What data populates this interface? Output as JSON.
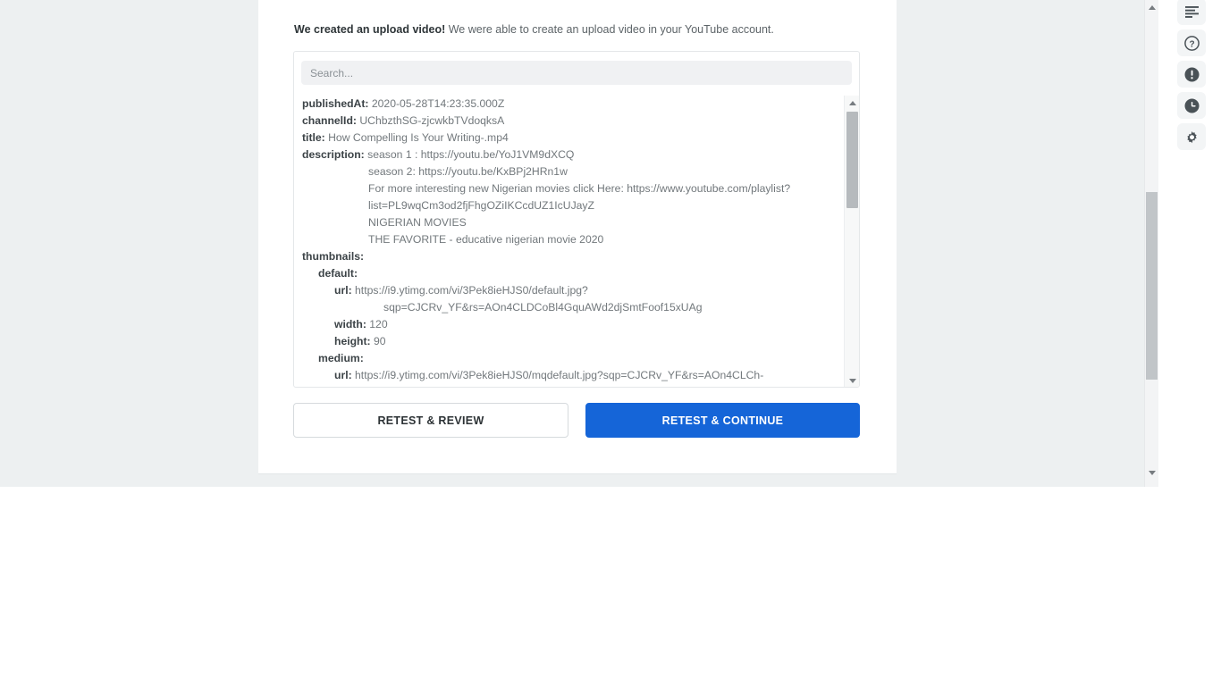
{
  "alert": {
    "strong": "We created an upload video!",
    "text": " We were able to create an upload video in your YouTube account."
  },
  "json_viewer": {
    "search": {
      "placeholder": "Search...",
      "value": ""
    },
    "rows": [
      {
        "indent": 0,
        "key": "publishedAt:",
        "value": "2020-05-28T14:23:35.000Z"
      },
      {
        "indent": 0,
        "key": "channelId:",
        "value": "UChbzthSG-zjcwkbTVdoqksA"
      },
      {
        "indent": 0,
        "key": "title:",
        "value": "How Compelling Is Your Writing-.mp4"
      },
      {
        "indent": 0,
        "key": "description:",
        "value": "season 1 : https://youtu.be/YoJ1VM9dXCQ"
      },
      {
        "indent": "desc",
        "key": "",
        "value": "season 2: https://youtu.be/KxBPj2HRn1w"
      },
      {
        "indent": "desc",
        "key": "",
        "value": "For more interesting new Nigerian movies click Here: https://www.youtube.com/playlist?"
      },
      {
        "indent": "desc",
        "key": "",
        "value": "list=PL9wqCm3od2fjFhgOZiIKCcdUZ1IcUJayZ"
      },
      {
        "indent": "desc",
        "key": "",
        "value": "NIGERIAN MOVIES"
      },
      {
        "indent": "desc",
        "key": "",
        "value": "THE FAVORITE - educative nigerian movie 2020"
      },
      {
        "indent": 0,
        "key": "thumbnails:",
        "value": ""
      },
      {
        "indent": 1,
        "key": "default:",
        "value": ""
      },
      {
        "indent": 2,
        "key": "url:",
        "value": "https://i9.ytimg.com/vi/3Pek8ieHJS0/default.jpg?"
      },
      {
        "indent": "url",
        "key": "",
        "value": "sqp=CJCRv_YF&rs=AOn4CLDCoBl4GquAWd2djSmtFoof15xUAg"
      },
      {
        "indent": 2,
        "key": "width:",
        "value": "120"
      },
      {
        "indent": 2,
        "key": "height:",
        "value": "90"
      },
      {
        "indent": 1,
        "key": "medium:",
        "value": ""
      },
      {
        "indent": 2,
        "key": "url:",
        "value": "https://i9.ytimg.com/vi/3Pek8ieHJS0/mqdefault.jpg?sqp=CJCRv_YF&rs=AOn4CLCh-"
      }
    ]
  },
  "actions": {
    "retest_review_label": "RETEST & REVIEW",
    "retest_continue_label": "RETEST & CONTINUE",
    "primary_color": "#1565d8"
  },
  "icon_rail": [
    {
      "name": "list-icon"
    },
    {
      "name": "help-circle-icon"
    },
    {
      "name": "alert-circle-icon"
    },
    {
      "name": "clock-icon"
    },
    {
      "name": "gear-icon"
    }
  ]
}
